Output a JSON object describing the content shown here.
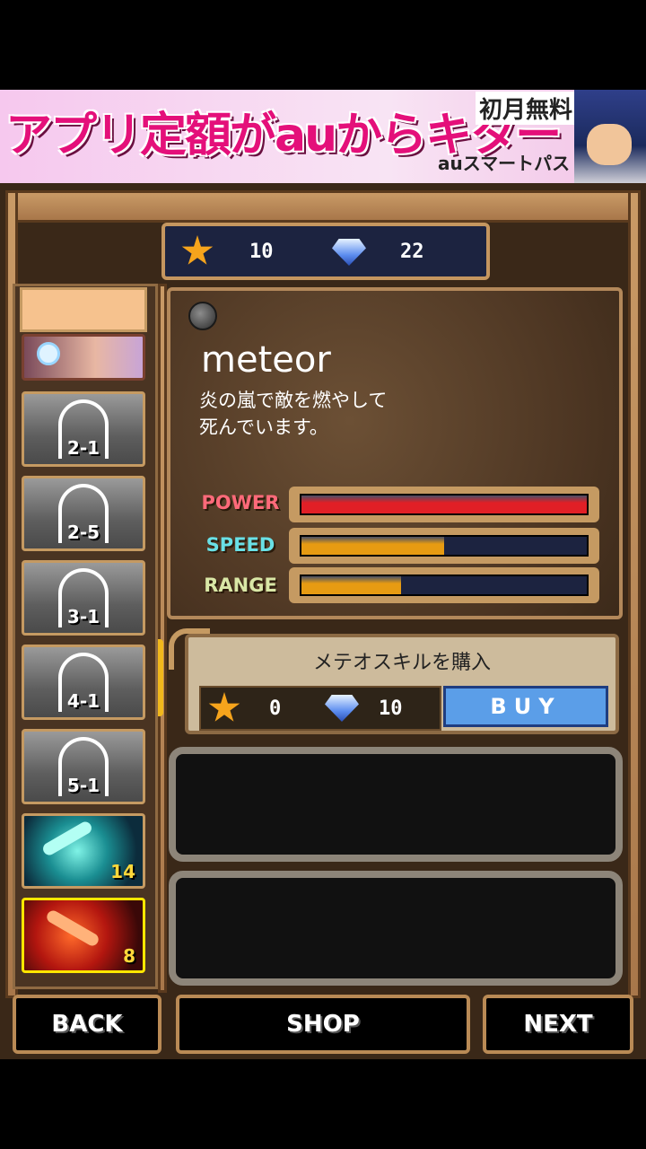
{
  "ad": {
    "headline": "アプリ定額がauからキター",
    "badge": "初月無料",
    "subtitle": "auスマートパス"
  },
  "currency": {
    "stars": "10",
    "gems": "22"
  },
  "skill_list": [
    {
      "type": "character",
      "label": ""
    },
    {
      "type": "locked",
      "label": "2-1"
    },
    {
      "type": "locked",
      "label": "2-5"
    },
    {
      "type": "locked",
      "label": "3-1"
    },
    {
      "type": "locked",
      "label": "4-1"
    },
    {
      "type": "locked",
      "label": "5-1"
    },
    {
      "type": "skill",
      "label": "14",
      "color": "#19b5a8"
    },
    {
      "type": "skill",
      "label": "8",
      "color": "#c8261a",
      "selected": true
    }
  ],
  "skill": {
    "name": "meteor",
    "desc_line1": "炎の嵐で敵を燃やして",
    "desc_line2": "死んでいます。",
    "stats": [
      {
        "label": "POWER",
        "value": 1.0,
        "color": "#e11f26",
        "label_color": "#ff6a7a"
      },
      {
        "label": "SPEED",
        "value": 0.5,
        "color": "#e79b12",
        "label_color": "#69e0e6"
      },
      {
        "label": "RANGE",
        "value": 0.35,
        "color": "#e79b12",
        "label_color": "#d9e7a6"
      }
    ]
  },
  "purchase": {
    "title": "メテオスキルを購入",
    "star_cost": "0",
    "gem_cost": "10",
    "buy_label": "BUY"
  },
  "nav": {
    "back": "BACK",
    "shop": "SHOP",
    "next": "NEXT"
  },
  "colors": {
    "frame_wood": "#c5965f",
    "panel_dark": "#1c2340",
    "buy_blue": "#5b9ee8"
  }
}
